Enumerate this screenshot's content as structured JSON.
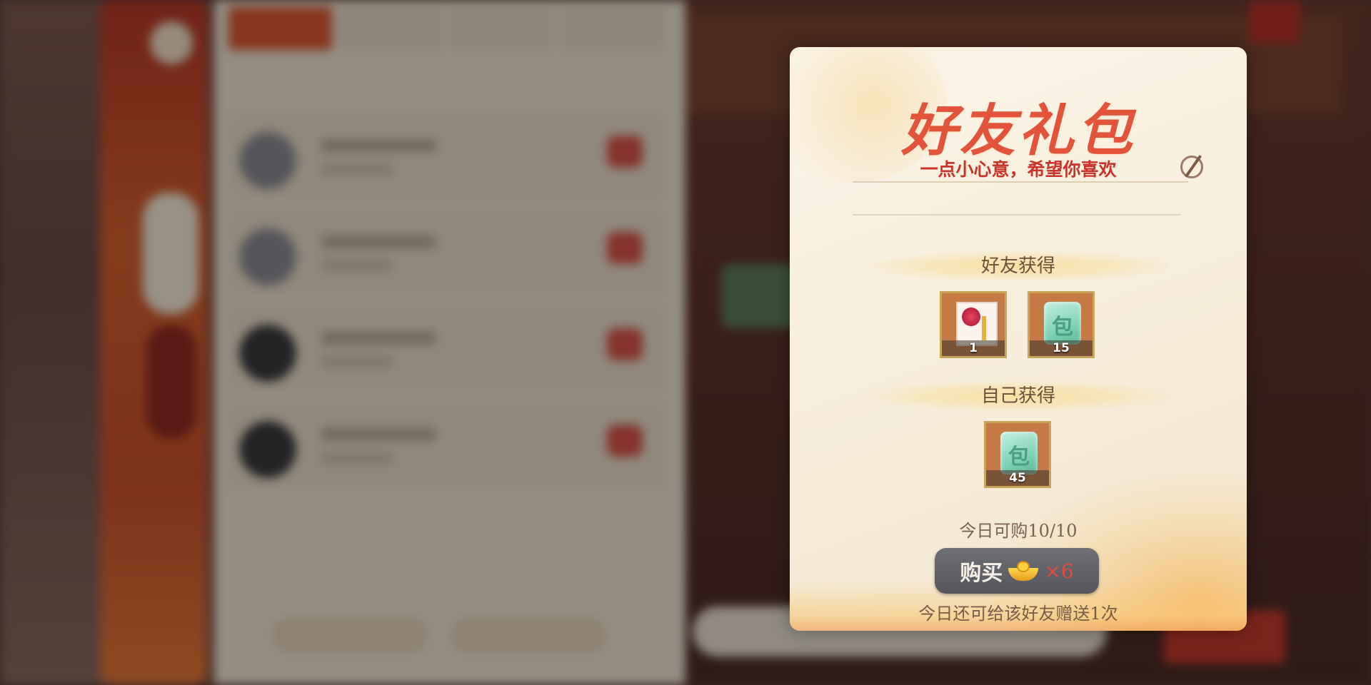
{
  "popup": {
    "title": "好友礼包",
    "message": "一点小心意，希望你喜欢",
    "friend_section_label": "好友获得",
    "self_section_label": "自己获得",
    "friend_items": [
      {
        "icon": "gift-card-icon",
        "count": "1"
      },
      {
        "icon": "jade-bag-icon",
        "count": "15"
      }
    ],
    "self_items": [
      {
        "icon": "jade-bag-icon",
        "count": "45"
      }
    ],
    "purchase_limit": "今日可购10/10",
    "buy_button": {
      "label": "购买",
      "currency_icon": "gold-ingot-icon",
      "price": "×6"
    },
    "gift_remaining": "今日还可给该好友赠送1次"
  },
  "colors": {
    "title": "#e2533a",
    "message": "#c9342a",
    "price": "#e44b3a",
    "button": "#5f5f66"
  }
}
